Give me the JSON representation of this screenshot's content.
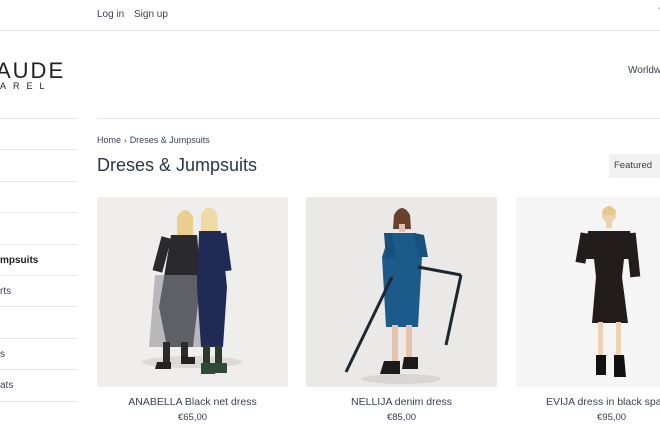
{
  "topbar": {
    "login": "Log in",
    "signup": "Sign up",
    "cart_edge": "'"
  },
  "brand": {
    "logo_word": "AUDE",
    "logo_sub": "AREL"
  },
  "header": {
    "region": "Worldwide"
  },
  "sidebar": {
    "items": [
      {
        "label": ""
      },
      {
        "label": ""
      },
      {
        "label": ""
      },
      {
        "label": ""
      },
      {
        "label": "",
        "active": false
      },
      {
        "label": "mpsuits",
        "active": true
      },
      {
        "label": "rts"
      },
      {
        "label": ""
      },
      {
        "label": "s"
      },
      {
        "label": "ats"
      }
    ]
  },
  "breadcrumb": {
    "home": "Home",
    "separator": "›",
    "current": "Dreses & Jumpsuits"
  },
  "page": {
    "title": "Dreses & Jumpsuits",
    "sort_label": "Featured"
  },
  "products": [
    {
      "name": "ANABELLA Black net dress",
      "price": "€65,00"
    },
    {
      "name": "NELLIJA denim dress",
      "price": "€85,00"
    },
    {
      "name": "EVIJA dress in black spar",
      "price": "€95,00"
    }
  ],
  "colors": {
    "text": "#3a3f4b",
    "title": "#2b3548",
    "rule": "#e6e6e6",
    "sort_bg": "#f2f2f2"
  }
}
